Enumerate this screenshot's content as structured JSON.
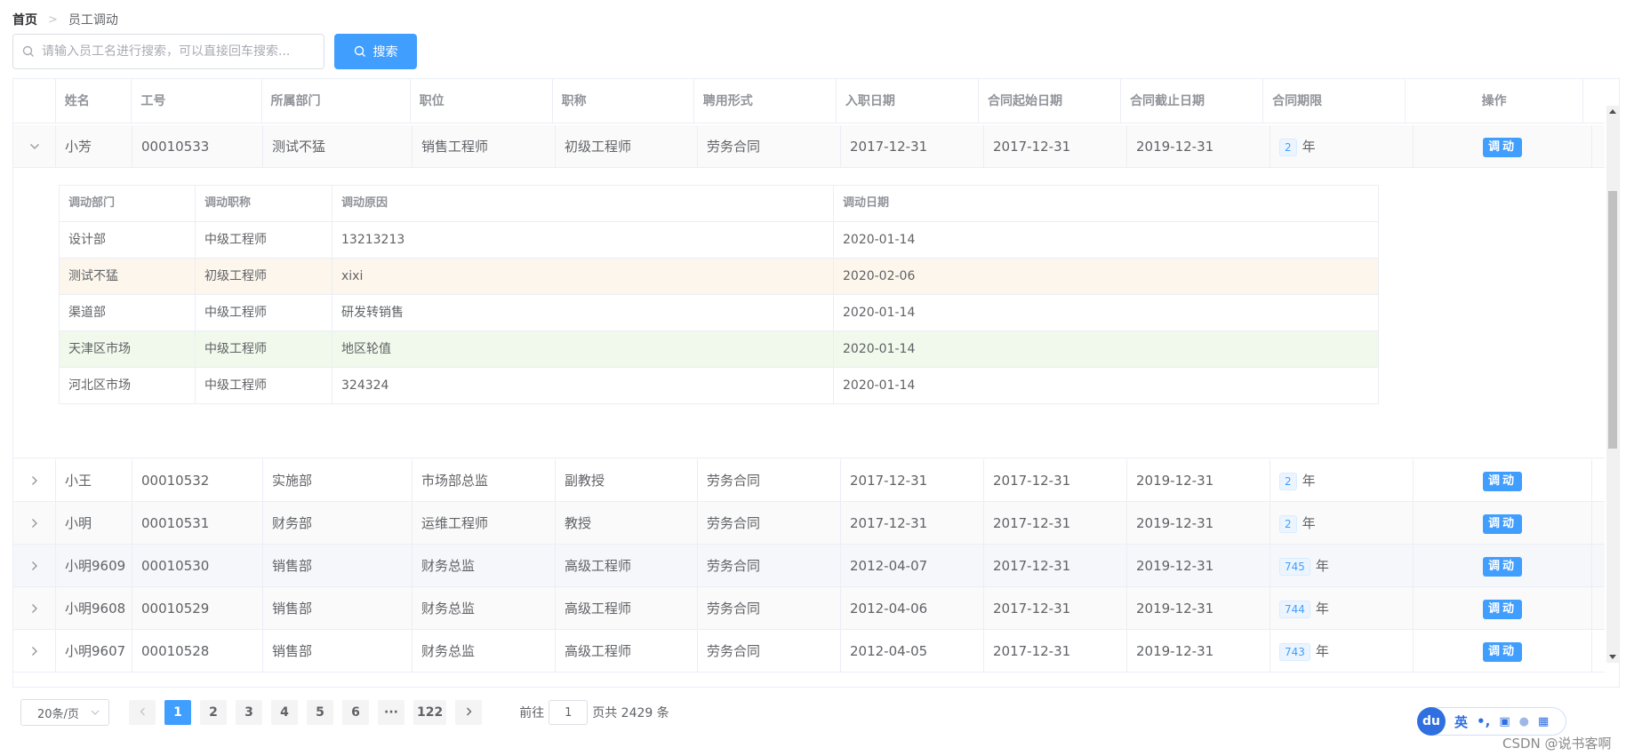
{
  "breadcrumb": {
    "home": "首页",
    "current": "员工调动"
  },
  "search": {
    "placeholder": "请输入员工名进行搜索，可以直接回车搜索...",
    "button_label": "搜索"
  },
  "table": {
    "headers": [
      "姓名",
      "工号",
      "所属部门",
      "职位",
      "职称",
      "聘用形式",
      "入职日期",
      "合同起始日期",
      "合同截止日期",
      "合同期限",
      "操作"
    ],
    "unit": "年",
    "action_label": "调动",
    "expanded_row": {
      "name": "小芳",
      "id": "00010533",
      "dept": "测试不猛",
      "position": "销售工程师",
      "title": "初级工程师",
      "employ": "劳务合同",
      "entry": "2017-12-31",
      "start": "2017-12-31",
      "end": "2019-12-31",
      "term": "2"
    },
    "rows": [
      {
        "name": "小王",
        "id": "00010532",
        "dept": "实施部",
        "position": "市场部总监",
        "title": "副教授",
        "employ": "劳务合同",
        "entry": "2017-12-31",
        "start": "2017-12-31",
        "end": "2019-12-31",
        "term": "2"
      },
      {
        "name": "小明",
        "id": "00010531",
        "dept": "财务部",
        "position": "运维工程师",
        "title": "教授",
        "employ": "劳务合同",
        "entry": "2017-12-31",
        "start": "2017-12-31",
        "end": "2019-12-31",
        "term": "2"
      },
      {
        "name": "小明9609",
        "id": "00010530",
        "dept": "销售部",
        "position": "财务总监",
        "title": "高级工程师",
        "employ": "劳务合同",
        "entry": "2012-04-07",
        "start": "2017-12-31",
        "end": "2019-12-31",
        "term": "745"
      },
      {
        "name": "小明9608",
        "id": "00010529",
        "dept": "销售部",
        "position": "财务总监",
        "title": "高级工程师",
        "employ": "劳务合同",
        "entry": "2012-04-06",
        "start": "2017-12-31",
        "end": "2019-12-31",
        "term": "744"
      },
      {
        "name": "小明9607",
        "id": "00010528",
        "dept": "销售部",
        "position": "财务总监",
        "title": "高级工程师",
        "employ": "劳务合同",
        "entry": "2012-04-05",
        "start": "2017-12-31",
        "end": "2019-12-31",
        "term": "743"
      }
    ]
  },
  "transfer": {
    "headers": [
      "调动部门",
      "调动职称",
      "调动原因",
      "调动日期"
    ],
    "rows": [
      {
        "dept": "设计部",
        "title": "中级工程师",
        "reason": "13213213",
        "date": "2020-01-14"
      },
      {
        "dept": "测试不猛",
        "title": "初级工程师",
        "reason": "xixi",
        "date": "2020-02-06"
      },
      {
        "dept": "渠道部",
        "title": "中级工程师",
        "reason": "研发转销售",
        "date": "2020-01-14"
      },
      {
        "dept": "天津区市场",
        "title": "中级工程师",
        "reason": "地区轮值",
        "date": "2020-01-14"
      },
      {
        "dept": "河北区市场",
        "title": "中级工程师",
        "reason": "324324",
        "date": "2020-01-14"
      }
    ]
  },
  "pagination": {
    "page_size": "20条/页",
    "pages": [
      "1",
      "2",
      "3",
      "4",
      "5",
      "6"
    ],
    "more": "···",
    "last": "122",
    "goto_prefix": "前往",
    "goto_value": "1",
    "goto_suffix": "页",
    "total": "共 2429 条"
  },
  "ime": {
    "logo": "du",
    "lang": "英",
    "punct": "•,"
  },
  "watermark": "CSDN @说书客啊",
  "colors": {
    "primary": "#409eff",
    "warning_row": "#fdf6ec",
    "success_row": "#f0f9eb",
    "border": "#ebeef5"
  }
}
